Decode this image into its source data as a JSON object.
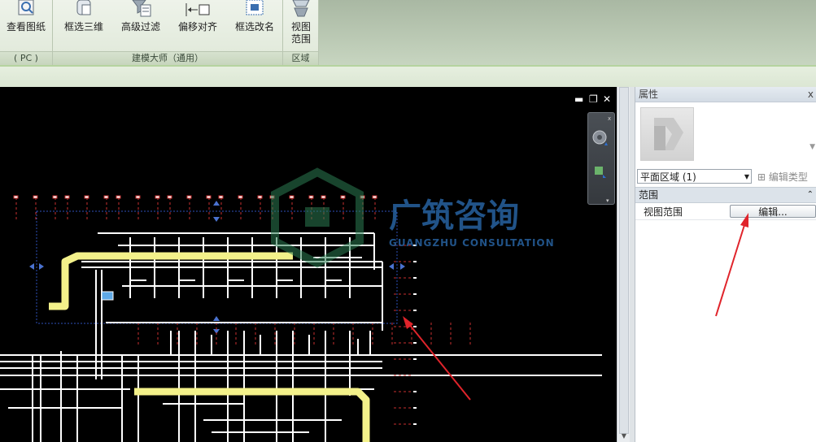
{
  "ribbon": {
    "buttons": [
      {
        "label": "查看图纸",
        "icon": "view-drawing-icon"
      },
      {
        "label": "框选三维",
        "icon": "box-select-3d-icon"
      },
      {
        "label": "高级过滤",
        "icon": "advanced-filter-icon"
      },
      {
        "label": "偏移对齐",
        "icon": "offset-align-icon"
      },
      {
        "label": "框选改名",
        "icon": "box-rename-icon"
      },
      {
        "label": "视图",
        "label2": "范围",
        "icon": "view-range-icon"
      }
    ],
    "panels": [
      "( PC )",
      "建模大师（通用）",
      "区域"
    ]
  },
  "view": {
    "window_controls": [
      "minimize",
      "restore",
      "close"
    ]
  },
  "watermark": {
    "name": "广筑咨询",
    "subtitle": "GUANGZHU CONSULTATION"
  },
  "properties": {
    "title": "属性",
    "close": "x",
    "type_selector": "平面区域 (1)",
    "edit_type": "编辑类型",
    "category": "范围",
    "rows": [
      {
        "name": "视图范围",
        "value": "编辑..."
      }
    ]
  },
  "colors": {
    "canvas_bg": "#000000",
    "annotation_arrow": "#e0242b",
    "pipe_yellow": "#f3f18a",
    "region_boundary": "#2e4fb8"
  }
}
